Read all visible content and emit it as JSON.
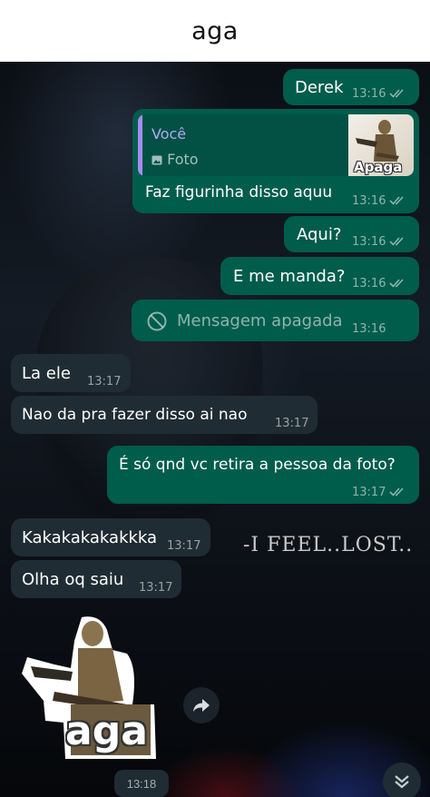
{
  "header": {
    "title": "aga"
  },
  "wallpaper": {
    "caption": "-I FEEL..LOST.."
  },
  "messages": [
    {
      "text": "Derek",
      "time": "13:16"
    },
    {
      "reply_author": "Você",
      "reply_type": "Foto",
      "thumb_caption": "Apaga",
      "text": "Faz figurinha disso aquu",
      "time": "13:16"
    },
    {
      "text": "Aqui?",
      "time": "13:16"
    },
    {
      "text": "E me manda?",
      "time": "13:16"
    },
    {
      "text": "Mensagem apagada",
      "time": "13:16"
    },
    {
      "text": "La ele",
      "time": "13:17"
    },
    {
      "text": "Nao da pra fazer disso ai nao",
      "time": "13:17"
    },
    {
      "text": "É só qnd vc retira a pessoa da foto?",
      "time": "13:17"
    },
    {
      "text": "Kakakakakakkka",
      "time": "13:17"
    },
    {
      "text": "Olha oq saiu",
      "time": "13:17"
    }
  ],
  "sticker": {
    "caption": "aga",
    "time": "13:18"
  },
  "icons": {
    "read_receipt": "double-check-icon",
    "deleted": "block-icon",
    "forward": "forward-icon",
    "scroll_down": "double-chevron-down-icon",
    "photo": "image-icon"
  },
  "colors": {
    "outgoing_bubble": "#005c4b",
    "incoming_bubble": "#202c33",
    "reply_author": "#b4a7f5",
    "reply_bar": "#a78bfa"
  }
}
